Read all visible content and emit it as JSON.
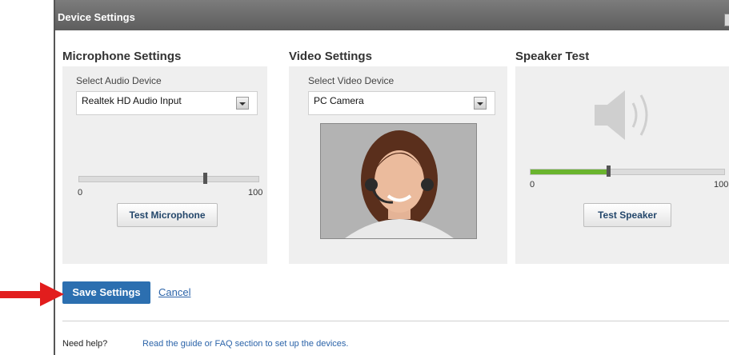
{
  "dialog": {
    "title": "Device Settings"
  },
  "microphone": {
    "title": "Microphone Settings",
    "select_label": "Select Audio Device",
    "device": "Realtek HD Audio Input",
    "slider_min": "0",
    "slider_max": "100",
    "level": 0.7,
    "button": "Test Microphone"
  },
  "video": {
    "title": "Video Settings",
    "select_label": "Select Video Device",
    "device": "PC Camera"
  },
  "speaker": {
    "title": "Speaker Test",
    "slider_min": "0",
    "slider_max": "100",
    "level": 0.4,
    "button": "Test Speaker"
  },
  "actions": {
    "save": "Save Settings",
    "cancel": "Cancel"
  },
  "help": {
    "label": "Need help?",
    "link": "Read the guide or FAQ section to set up the devices."
  },
  "colors": {
    "save_bg": "#2c6fb0",
    "slider_fill": "#6ab42e",
    "arrow": "#e21d1d"
  }
}
